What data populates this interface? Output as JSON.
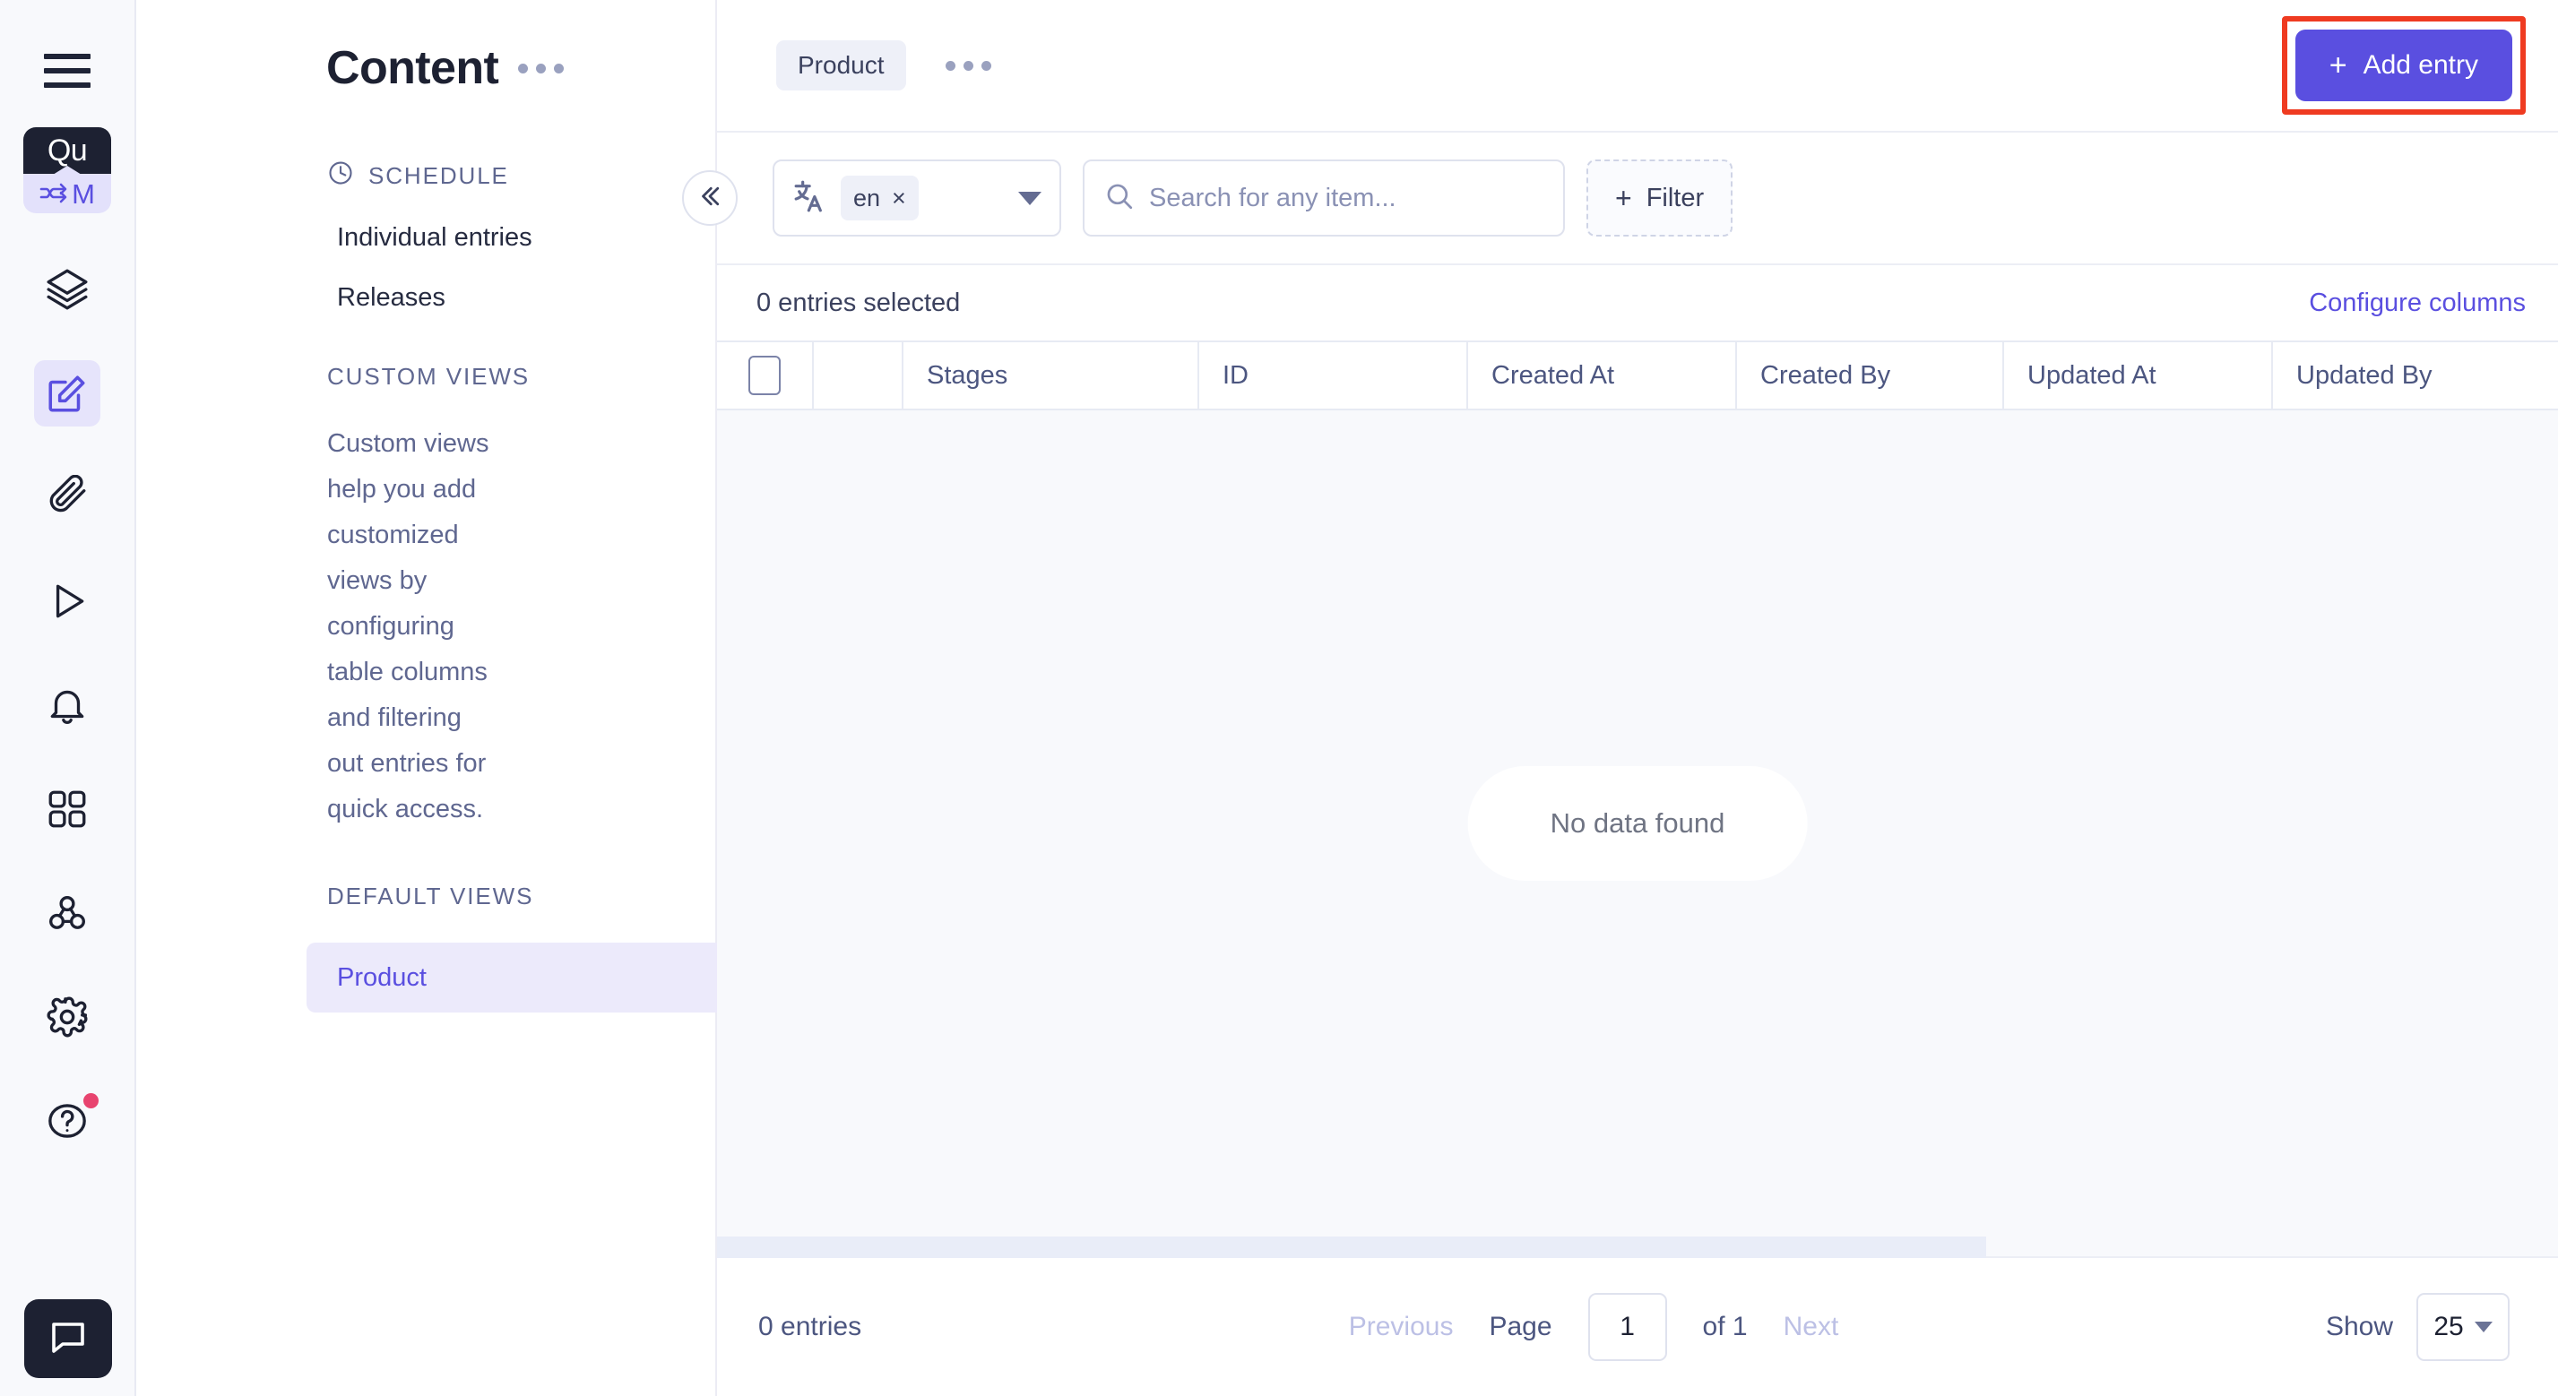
{
  "rail": {
    "menu_icon": "hamburger-menu-icon",
    "logo": {
      "top_text": "Qu",
      "bottom_text": "M",
      "bottom_icon": "shuffle-icon"
    },
    "items": [
      {
        "name": "layers",
        "icon": "layers-icon",
        "active": false
      },
      {
        "name": "content",
        "icon": "edit-square-icon",
        "active": true
      },
      {
        "name": "assets",
        "icon": "paperclip-icon",
        "active": false
      },
      {
        "name": "releases",
        "icon": "play-triangle-icon",
        "active": false
      },
      {
        "name": "notifications",
        "icon": "bell-icon",
        "active": false
      },
      {
        "name": "apps",
        "icon": "grid-apps-icon",
        "active": false
      },
      {
        "name": "webhooks",
        "icon": "webhook-icon",
        "active": false
      },
      {
        "name": "settings",
        "icon": "gear-icon",
        "active": false
      },
      {
        "name": "help",
        "icon": "question-circle-icon",
        "active": false,
        "badge": true
      }
    ],
    "chat": {
      "icon": "chat-bubble-icon"
    }
  },
  "navpanel": {
    "title": "Content",
    "more_icon": "ellipsis-icon",
    "schedule": {
      "label": "SCHEDULE",
      "icon": "clock-icon",
      "items": [
        {
          "label": "Individual entries"
        },
        {
          "label": "Releases"
        }
      ]
    },
    "custom_views": {
      "label": "CUSTOM VIEWS",
      "description": "Custom views help you add customized views by configuring table columns and filtering out entries for quick access."
    },
    "default_views": {
      "label": "DEFAULT VIEWS",
      "items": [
        {
          "label": "Product",
          "selected": true
        }
      ]
    }
  },
  "topbar": {
    "tab_label": "Product",
    "more_icon": "ellipsis-icon",
    "add_entry": {
      "label": "Add entry",
      "plus": "+",
      "highlighted": true
    }
  },
  "filterbar": {
    "collapse_icon": "double-chevron-left-icon",
    "language": {
      "icon": "translate-icon",
      "chip_label": "en",
      "chip_remove": "×",
      "caret_icon": "chevron-down-icon"
    },
    "search": {
      "icon": "search-icon",
      "value": "",
      "placeholder": "Search for any item..."
    },
    "filter": {
      "label": "Filter",
      "plus": "+"
    }
  },
  "table": {
    "selected_text": "0 entries selected",
    "configure_columns": "Configure columns",
    "columns": [
      {
        "label": "",
        "kind": "checkbox"
      },
      {
        "label": "",
        "kind": "blank"
      },
      {
        "label": "Stages"
      },
      {
        "label": "ID"
      },
      {
        "label": "Created At"
      },
      {
        "label": "Created By"
      },
      {
        "label": "Updated At"
      },
      {
        "label": "Updated By"
      }
    ],
    "rows": [],
    "empty_message": "No data found"
  },
  "pagination": {
    "entries_text": "0 entries",
    "previous": "Previous",
    "page_label": "Page",
    "page_value": "1",
    "of_text": "of 1",
    "next": "Next",
    "show_label": "Show",
    "show_value": "25"
  },
  "colors": {
    "accent": "#5a4fe0",
    "accent_soft": "#eceafb",
    "dark": "#1d2132",
    "highlight_box": "#ef3b21",
    "badge": "#e8446f",
    "panel_bg": "#f8f9fc"
  }
}
